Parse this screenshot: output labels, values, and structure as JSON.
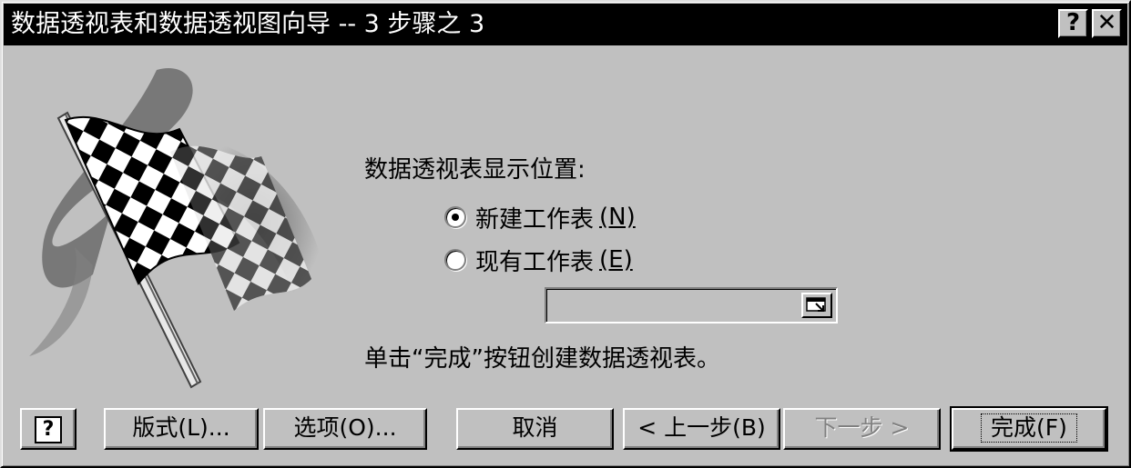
{
  "window": {
    "title": "数据透视表和数据透视图向导 -- 3 步骤之 3",
    "help_glyph": "?",
    "close_glyph": "✕"
  },
  "main": {
    "prompt": "数据透视表显示位置:",
    "radio_new": {
      "label": "新建工作表",
      "accel": "(N)",
      "checked": true
    },
    "radio_existing": {
      "label": "现有工作表",
      "accel": "(E)",
      "checked": false
    },
    "range_value": "",
    "info": "单击“完成”按钮创建数据透视表。"
  },
  "buttons": {
    "help": "?",
    "layout": "版式(L)...",
    "options": "选项(O)...",
    "cancel": "取消",
    "back": "< 上一步(B)",
    "next": "下一步 >",
    "finish": "完成(F)"
  },
  "icons": {
    "flag": "checkered-flag-icon",
    "help": "help-icon",
    "close": "close-icon",
    "range_select": "collapse-dialog-icon"
  }
}
